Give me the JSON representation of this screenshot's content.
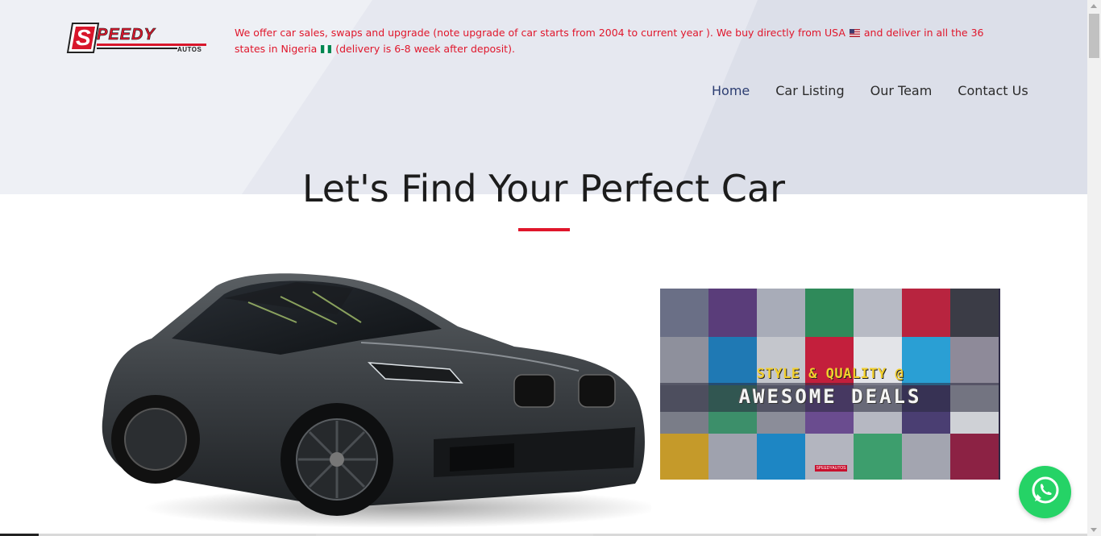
{
  "brand": {
    "logo_text": "SPEEDY",
    "logo_sub": "AUTOS",
    "accent": "#e0162b",
    "nav_active_color": "#2d3e72"
  },
  "header": {
    "announcement_part1": "We offer car sales, swaps and upgrade (note upgrade of car starts from 2004 to current year ). We buy directly from USA",
    "announcement_part2": "and deliver in all the 36 states in Nigeria",
    "announcement_part3": "(delivery is 6-8 week after deposit).",
    "flag_usa_icon": "us-flag-icon",
    "flag_nigeria_icon": "nigeria-flag-icon"
  },
  "nav": {
    "items": [
      {
        "label": "Home",
        "active": true
      },
      {
        "label": "Car Listing",
        "active": false
      },
      {
        "label": "Our Team",
        "active": false
      },
      {
        "label": "Contact Us",
        "active": false
      }
    ]
  },
  "hero": {
    "title": "Let's Find Your Perfect Car"
  },
  "promo": {
    "line1": "STYLE & QUALITY @",
    "line2": "AWESOME DEALS",
    "tag": "SPEEDYAUTOS"
  },
  "widgets": {
    "whatsapp_icon": "whatsapp-icon"
  }
}
